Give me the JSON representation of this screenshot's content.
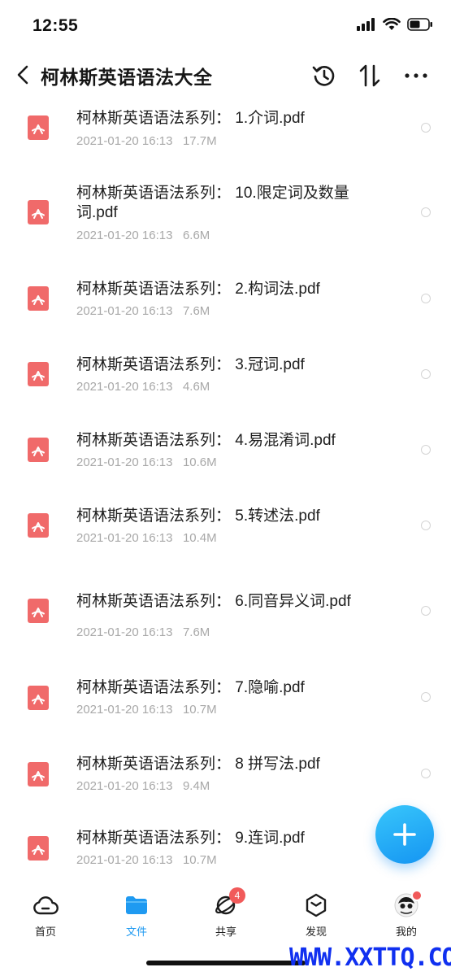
{
  "status": {
    "time": "12:55"
  },
  "header": {
    "title": "柯林斯英语语法大全"
  },
  "files": [
    {
      "name": "柯林斯英语语法系列：  1.介词.pdf",
      "date": "2021-01-20 16:13",
      "size": "17.7M"
    },
    {
      "name": "柯林斯英语语法系列：  10.限定词及数量词.pdf",
      "date": "2021-01-20 16:13",
      "size": "6.6M"
    },
    {
      "name": "柯林斯英语语法系列：  2.构词法.pdf",
      "date": "2021-01-20 16:13",
      "size": "7.6M"
    },
    {
      "name": "柯林斯英语语法系列：  3.冠词.pdf",
      "date": "2021-01-20 16:13",
      "size": "4.6M"
    },
    {
      "name": "柯林斯英语语法系列：  4.易混淆词.pdf",
      "date": "2021-01-20 16:13",
      "size": "10.6M"
    },
    {
      "name": "柯林斯英语语法系列：  5.转述法.pdf",
      "date": "2021-01-20 16:13",
      "size": "10.4M"
    },
    {
      "name": "柯林斯英语语法系列：  6.同音异义词.pdf",
      "date": "2021-01-20 16:13",
      "size": "7.6M"
    },
    {
      "name": "柯林斯英语语法系列：  7.隐喻.pdf",
      "date": "2021-01-20 16:13",
      "size": "10.7M"
    },
    {
      "name": "柯林斯英语语法系列：  8  拼写法.pdf",
      "date": "2021-01-20 16:13",
      "size": "9.4M"
    },
    {
      "name": "柯林斯英语语法系列：  9.连词.pdf",
      "date": "2021-01-20 16:13",
      "size": "10.7M"
    }
  ],
  "tabs": [
    {
      "label": "首页",
      "icon": "cloud-home-icon",
      "active": false
    },
    {
      "label": "文件",
      "icon": "folder-icon",
      "active": true
    },
    {
      "label": "共享",
      "icon": "orbit-share-icon",
      "active": false,
      "badge": "4"
    },
    {
      "label": "发现",
      "icon": "hexagon-discover-icon",
      "active": false
    },
    {
      "label": "我的",
      "icon": "avatar-icon",
      "active": false
    }
  ],
  "colors": {
    "accent": "#1f9af1",
    "pdf": "#f06a6a",
    "badge": "#f15a5a",
    "watermark": "#1030f0"
  },
  "watermark": "WWW.XXTTQ.COM"
}
